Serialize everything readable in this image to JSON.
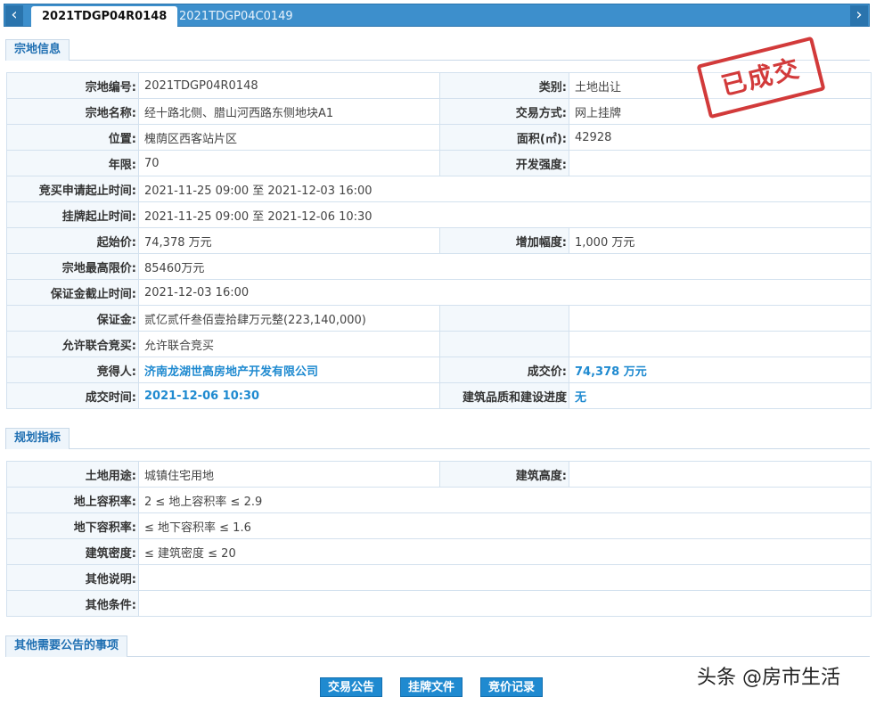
{
  "tabs": {
    "prev_icon": "chevron-left-icon",
    "next_icon": "chevron-right-icon",
    "items": [
      {
        "label": "2021TDGP04R0148",
        "active": true
      },
      {
        "label": "2021TDGP04C0149",
        "active": false
      }
    ]
  },
  "stamp": {
    "text": "已成交",
    "color": "#d23a3a"
  },
  "parcel": {
    "section_title": "宗地信息",
    "parcel_no_label": "宗地编号:",
    "parcel_no": "2021TDGP04R0148",
    "category_label": "类别:",
    "category": "土地出让",
    "name_label": "宗地名称:",
    "name": "经十路北侧、腊山河西路东侧地块A1",
    "trade_mode_label": "交易方式:",
    "trade_mode": "网上挂牌",
    "location_label": "位置:",
    "location": "槐荫区西客站片区",
    "area_label": "面积(㎡):",
    "area": "42928",
    "term_label": "年限:",
    "term": "70",
    "intensity_label": "开发强度:",
    "intensity": "",
    "bid_apply_label": "竞买申请起止时间:",
    "bid_apply": "2021-11-25 09:00 至 2021-12-03 16:00",
    "listing_label": "挂牌起止时间:",
    "listing": "2021-11-25 09:00 至 2021-12-06 10:30",
    "start_price_label": "起始价:",
    "start_price": "74,378 万元",
    "increment_label": "增加幅度:",
    "increment": "1,000 万元",
    "max_price_label": "宗地最高限价:",
    "max_price": "85460万元",
    "deposit_deadline_label": "保证金截止时间:",
    "deposit_deadline": "2021-12-03 16:00",
    "deposit_label": "保证金:",
    "deposit": "贰亿贰仟叁佰壹拾肆万元整(223,140,000)",
    "joint_bid_label": "允许联合竞买:",
    "joint_bid": "允许联合竞买",
    "winner_label": "竞得人:",
    "winner": "济南龙湖世高房地产开发有限公司",
    "deal_price_label": "成交价:",
    "deal_price": "74,378 万元",
    "deal_time_label": "成交时间:",
    "deal_time": "2021-12-06 10:30",
    "quality_label": "建筑品质和建设进度",
    "quality": "无"
  },
  "planning": {
    "section_title": "规划指标",
    "land_use_label": "土地用途:",
    "land_use": "城镇住宅用地",
    "height_label": "建筑高度:",
    "height": "",
    "far_above_label": "地上容积率:",
    "far_above": "2 ≤ 地上容积率 ≤ 2.9",
    "far_below_label": "地下容积率:",
    "far_below": "≤ 地下容积率 ≤ 1.6",
    "density_label": "建筑密度:",
    "density": "≤ 建筑密度 ≤ 20",
    "other_note_label": "其他说明:",
    "other_note": "",
    "other_cond_label": "其他条件:",
    "other_cond": ""
  },
  "notice": {
    "section_title": "其他需要公告的事项"
  },
  "buttons": {
    "announcement": "交易公告",
    "listing_docs": "挂牌文件",
    "bid_records": "竞价记录"
  },
  "watermark": "头条 @房市生活",
  "colors": {
    "accent": "#1f8ad0",
    "tabbar": "#3d8fcc",
    "stamp": "#d23a3a"
  }
}
